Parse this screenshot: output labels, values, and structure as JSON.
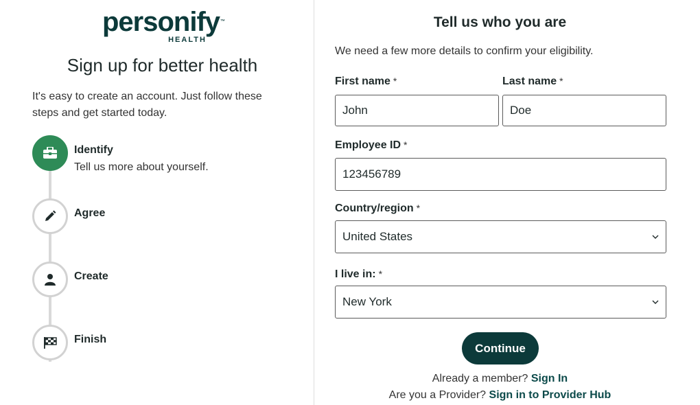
{
  "brand": {
    "logo_main": "personify",
    "logo_sub": "HEALTH",
    "logo_tm": "™"
  },
  "left": {
    "title": "Sign up for better health",
    "intro": "It's easy to create an account. Just follow these steps and get started today.",
    "steps": [
      {
        "label": "Identify",
        "desc": "Tell us more about yourself.",
        "icon": "briefcase-icon",
        "active": true
      },
      {
        "label": "Agree",
        "icon": "pencil-icon",
        "active": false
      },
      {
        "label": "Create",
        "icon": "user-icon",
        "active": false
      },
      {
        "label": "Finish",
        "icon": "checkered-flag-icon",
        "active": false
      }
    ]
  },
  "form": {
    "title": "Tell us who you are",
    "subtitle": "We need a few more details to confirm your eligibility.",
    "required_marker": "*",
    "first_name": {
      "label": "First name",
      "value": "John"
    },
    "last_name": {
      "label": "Last name",
      "value": "Doe"
    },
    "employee_id": {
      "label": "Employee ID",
      "value": "123456789"
    },
    "country": {
      "label": "Country/region",
      "value": "United States"
    },
    "state": {
      "label": "I live in:",
      "value": "New York"
    },
    "continue_label": "Continue"
  },
  "footer": {
    "member_text": "Already a member?",
    "member_link": "Sign In",
    "provider_text": "Are you a Provider?",
    "provider_link": "Sign in to Provider Hub"
  },
  "colors": {
    "brand_dark": "#0c3a3a",
    "active_step": "#2e8b57"
  }
}
